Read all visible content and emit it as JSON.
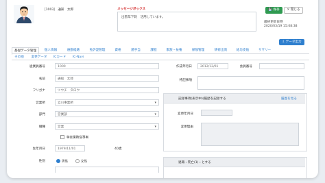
{
  "header": {
    "employee_name": "［1003］ 通知　太郎",
    "message_title": "メッセージボックス",
    "message_text": "出張年下刺　活用しています。",
    "save_label": "保存",
    "close_label": "閉じる",
    "updated_label": "最終更新日時",
    "updated_value": "2020/03/19 15:08:38",
    "export_label": "データ出力"
  },
  "tabs": {
    "row1": [
      "基礎データ管理",
      "個人情報",
      "通勤経路",
      "免許証管理",
      "資格",
      "諸手当",
      "課程",
      "家族・扶養",
      "保険管理",
      "研修出向",
      "給与支給",
      "サマリー"
    ],
    "row2": [
      "その他",
      "変更データ",
      "ICカード",
      "IC-Navi"
    ]
  },
  "form": {
    "emp_no_label": "従業員番号",
    "emp_no_value": "1000",
    "name_label": "名前",
    "name_value": "通知　太郎",
    "kana_label": "フリガナ",
    "kana_value": "ツウチ　タロウ",
    "office_label": "営業所",
    "office_value": "立川事業所",
    "dept_label": "部門",
    "dept_value": "営業部",
    "position_label": "職種",
    "position_value": "営業",
    "disabled_label": "特定業務従事者",
    "birth_label": "生年月日",
    "birth_value": "1979/11/01",
    "age_value": "40歳",
    "gender_label": "性別",
    "gender_male": "男性",
    "gender_female": "女性",
    "hire_label": "作成年月日",
    "hire_value": "2012/12/01",
    "insurance_label": "会員番号",
    "insurance_value": "",
    "memo_label": "特記事項",
    "history_title": "記録事項(表示中)(履歴を記録する",
    "history_link": "履歴を見る",
    "history_date_label": "変更年月日",
    "history_reason_label": "変更理由",
    "bottom_title": "退職・死亡(1)・とする"
  }
}
